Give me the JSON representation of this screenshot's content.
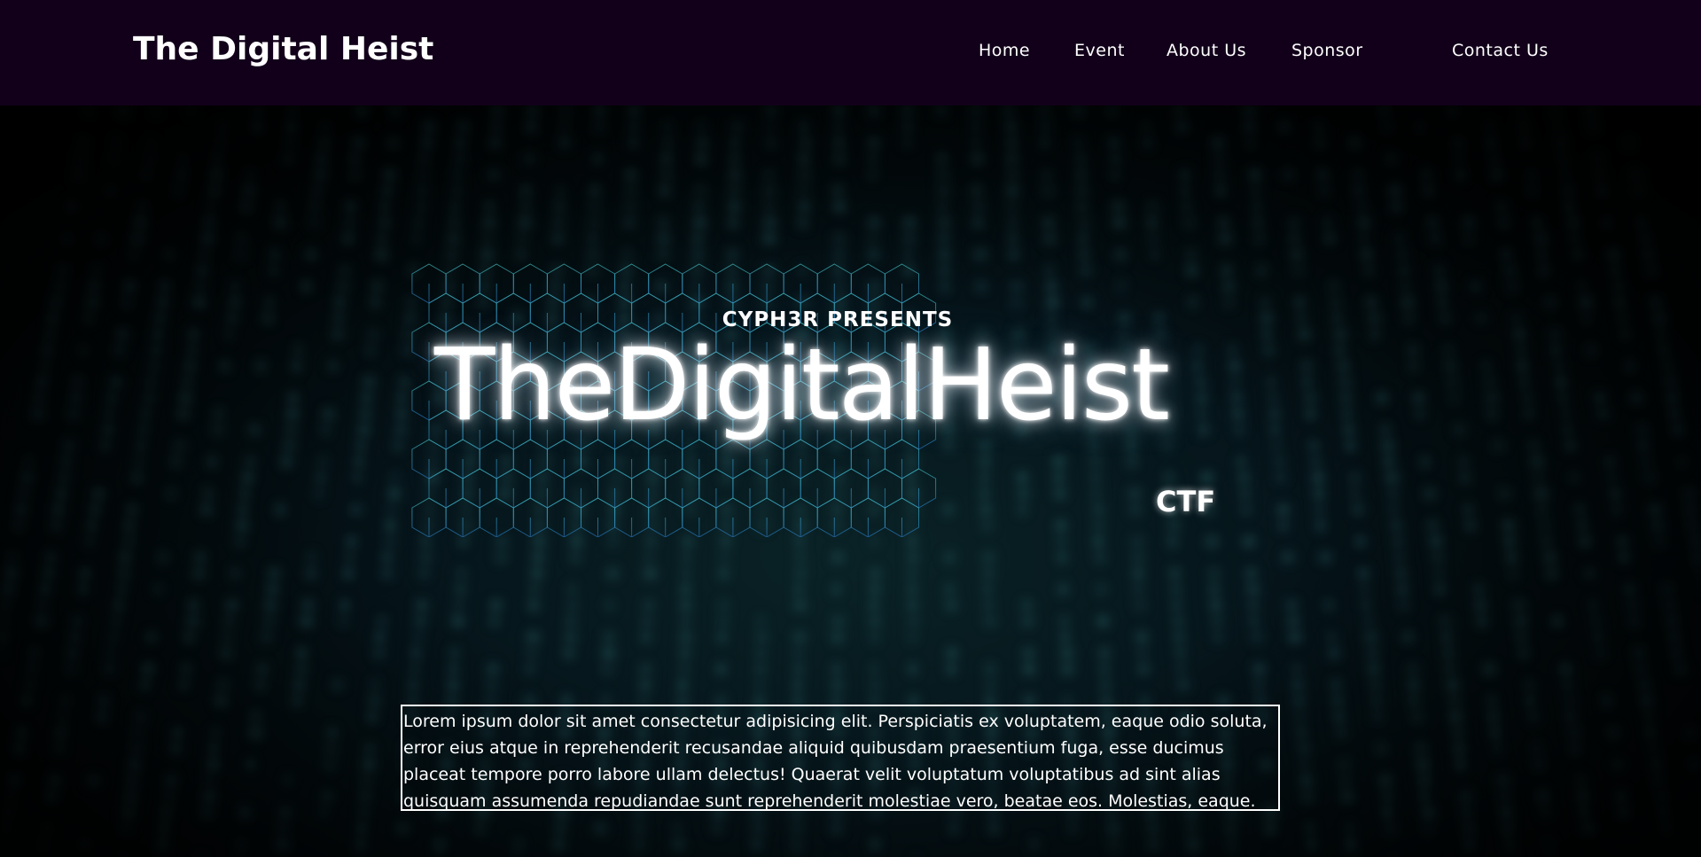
{
  "navbar": {
    "brand": "The Digital Heist",
    "links": [
      "Home",
      "Event",
      "About Us",
      "Sponsor",
      "Contact Us"
    ]
  },
  "hero": {
    "presenter": "CYPH3R PRESENTS",
    "title": "TheDigitalHeist",
    "tag": "CTF",
    "description": "Lorem ipsum dolor sit amet consectetur adipisicing elit. Perspiciatis ex voluptatem, eaque odio soluta, error eius atque in reprehenderit recusandae aliquid quibusdam praesentium fuga, esse ducimus placeat tempore porro labore ullam delectus! Quaerat velit voluptatum voluptatibus ad sint alias quisquam assumenda repudiandae sunt reprehenderit molestiae vero, beatae eos. Molestias, eaque."
  },
  "colors": {
    "navbar_bg": "#12001a",
    "hero_accent": "#2aa7b0",
    "text": "#ffffff"
  }
}
